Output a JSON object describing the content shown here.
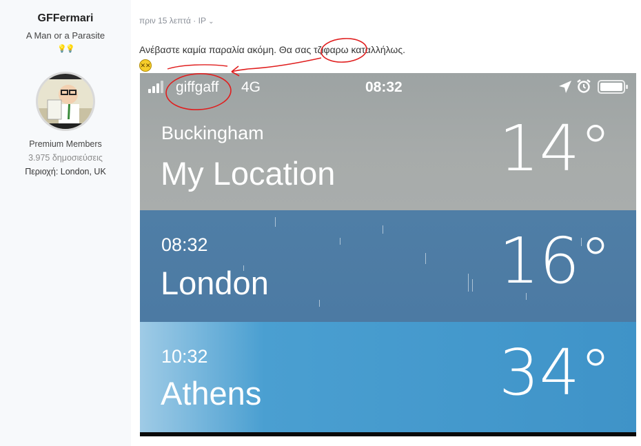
{
  "author": {
    "name": "GFFermari",
    "title": "A Man or a Parasite",
    "reputation_icons": "💡💡",
    "group": "Premium Members",
    "posts": "3.975 δημοσιεύσεις",
    "location": "Περιοχή: London, UK"
  },
  "post": {
    "time": "πριν 15 λεπτά",
    "ip": "IP",
    "text": "Ανέβαστε καμία παραλία ακόμη. Θα σας τζιφαρω καταλλήλως.",
    "emoji": "😵"
  },
  "phone": {
    "carrier": "giffgaff",
    "network": "4G",
    "time": "08:32",
    "icons": [
      "signal-icon",
      "location-arrow-icon",
      "alarm-icon",
      "battery-icon"
    ],
    "locations": [
      {
        "subtitle": "Buckingham",
        "city": "My Location",
        "temp": "14°"
      },
      {
        "subtitle": "08:32",
        "city": "London",
        "temp": "16°"
      },
      {
        "subtitle": "10:32",
        "city": "Athens",
        "temp": "34°"
      }
    ]
  },
  "colors": {
    "sidebar_bg": "#f7f9fb",
    "annotation_red": "#e01e1e",
    "row_gray": "#a3a8a8",
    "row_blue": "#4e7ca4",
    "row_sky": "#3f93c8"
  }
}
